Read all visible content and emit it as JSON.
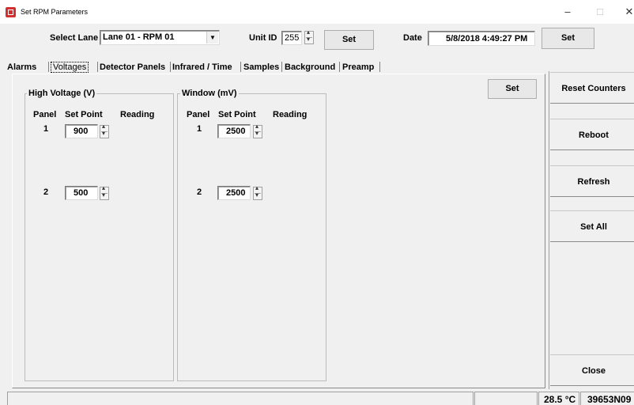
{
  "window": {
    "title": "Set RPM Parameters",
    "minimize": "–",
    "maximize": "□",
    "close": "✕"
  },
  "header": {
    "lane_label": "Select Lane",
    "lane_value": "Lane 01 - RPM 01",
    "unit_label": "Unit ID",
    "unit_value": "255",
    "unit_set": "Set",
    "date_label": "Date",
    "date_value": "5/8/2018 4:49:27 PM",
    "date_set": "Set"
  },
  "tabs": [
    "Alarms",
    "Voltages",
    "Detector Panels",
    "Infrared / Time",
    "Samples",
    "Background",
    "Preamp"
  ],
  "voltages": {
    "set_label": "Set",
    "high_voltage": {
      "title": "High Voltage (V)",
      "col_panel": "Panel",
      "col_setpoint": "Set Point",
      "col_reading": "Reading",
      "rows": [
        {
          "panel": "1",
          "setpoint": "900",
          "reading": ""
        },
        {
          "panel": "2",
          "setpoint": "500",
          "reading": ""
        }
      ]
    },
    "window": {
      "title": "Window (mV)",
      "col_panel": "Panel",
      "col_setpoint": "Set Point",
      "col_reading": "Reading",
      "rows": [
        {
          "panel": "1",
          "setpoint": "2500",
          "reading": ""
        },
        {
          "panel": "2",
          "setpoint": "2500",
          "reading": ""
        }
      ]
    }
  },
  "sidebar": {
    "reset_counters": "Reset Counters",
    "reboot": "Reboot",
    "refresh": "Refresh",
    "set_all": "Set All",
    "close": "Close"
  },
  "statusbar": {
    "temperature": "28.5 °C",
    "serial": "39653N09"
  }
}
